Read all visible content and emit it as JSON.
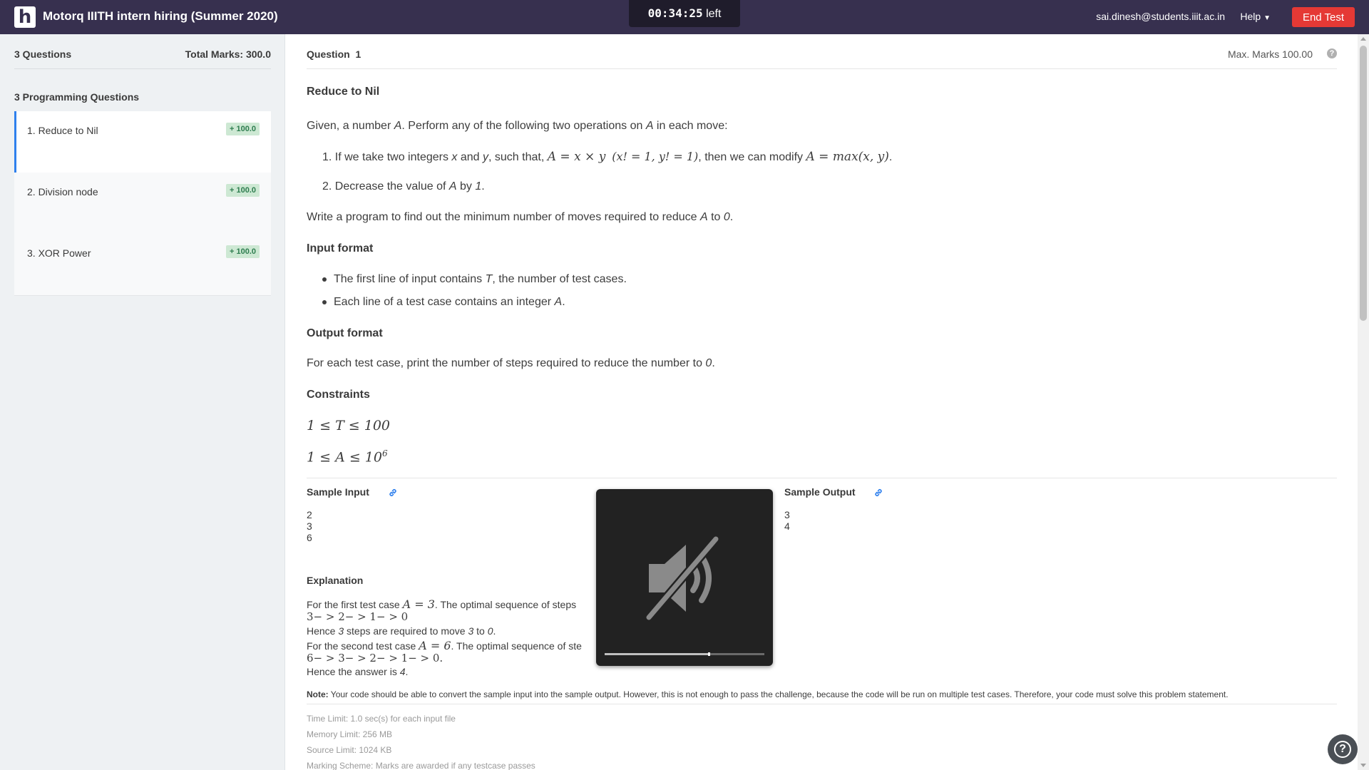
{
  "header": {
    "logo_letter": "h",
    "title": "Motorq IIITH intern hiring (Summer 2020)",
    "timer": {
      "time": "00:34:25",
      "suffix": "left"
    },
    "user_email": "sai.dinesh@students.iiit.ac.in",
    "help_label": "Help",
    "end_test_label": "End Test"
  },
  "sidebar": {
    "question_count": "3 Questions",
    "total_marks": "Total Marks: 300.0",
    "section_title": "3 Programming Questions",
    "questions": [
      {
        "label": "1. Reduce to Nil",
        "marks": "+ 100.0",
        "active": true
      },
      {
        "label": "2. Division node",
        "marks": "+ 100.0",
        "active": false
      },
      {
        "label": "3. XOR Power",
        "marks": "+ 100.0",
        "active": false
      }
    ]
  },
  "question": {
    "label": "Question",
    "number": "1",
    "max_marks": "Max. Marks 100.00",
    "title": "Reduce to Nil",
    "statement": {
      "p1_a": "Given, a number ",
      "p1_var": "A",
      "p1_b": ". Perform any of the following two operations on ",
      "p1_var2": "A",
      "p1_c": " in each move:",
      "op1_a": "1. If we take two integers ",
      "op1_x": "x",
      "op1_and": " and ",
      "op1_y": "y",
      "op1_b": ", such that, ",
      "op1_math1": "A = x × y",
      "op1_math2": "(x! = 1, y! = 1)",
      "op1_c": ", then we can modify ",
      "op1_math3": "A = max(x, y)",
      "op1_d": ".",
      "op2_a": "2. Decrease the value of ",
      "op2_var": "A",
      "op2_b": " by ",
      "op2_one": "1",
      "op2_c": ".",
      "p2_a": "Write a program to find out the minimum number of moves required to reduce ",
      "p2_var": "A",
      "p2_b": " to ",
      "p2_zero": "0",
      "p2_c": "."
    },
    "input_format": {
      "title": "Input format",
      "b1_a": "The first line of input contains ",
      "b1_var": "T",
      "b1_b": ", the number of test cases.",
      "b2_a": "Each line of a test case contains an integer ",
      "b2_var": "A",
      "b2_b": "."
    },
    "output_format": {
      "title": "Output format",
      "text_a": "For each test case, print the number of steps required to reduce the number to ",
      "text_zero": "0",
      "text_b": "."
    },
    "constraints": {
      "title": "Constraints",
      "c1": "1 ≤ T ≤ 100",
      "c2_base": "1 ≤ A ≤ 10",
      "c2_exp": "6"
    },
    "sample_input": {
      "title": "Sample Input",
      "text": "2\n3\n6"
    },
    "sample_output": {
      "title": "Sample Output",
      "text": "3\n4"
    },
    "explanation": {
      "title": "Explanation",
      "l1_a": "For the first test case ",
      "l1_math": "A = 3",
      "l1_b": ". The optimal sequence of steps",
      "l2": "3− > 2− > 1− > 0",
      "l3_a": "Hence ",
      "l3_n": "3",
      "l3_b": " steps are required to move ",
      "l3_from": "3",
      "l3_to": " to ",
      "l3_zero": "0",
      "l3_c": ".",
      "l4_a": "For the second test case ",
      "l4_math": "A = 6",
      "l4_b": ". The optimal sequence of ste",
      "l5": "6− > 3− > 2− > 1− > 0",
      "l5_dot": ".",
      "l6_a": "Hence the answer is ",
      "l6_n": "4",
      "l6_b": "."
    },
    "note_label": "Note:",
    "note_text": " Your code should be able to convert the sample input into the sample output. However, this is not enough to pass the challenge, because the code will be run on multiple test cases. Therefore, your code must solve this problem statement.",
    "limits": {
      "time": "Time Limit: 1.0 sec(s) for each input file",
      "memory": "Memory Limit: 256 MB",
      "source": "Source Limit: 1024 KB",
      "marking": "Marking Scheme: Marks are awarded if any testcase passes"
    }
  },
  "video": {
    "muted": true,
    "progress": 0.65
  },
  "colors": {
    "topbar": "#37304f",
    "end_test": "#e53935",
    "active_accent": "#2f80ed",
    "badge_bg": "#cde8d3",
    "link": "#2f80ed"
  }
}
